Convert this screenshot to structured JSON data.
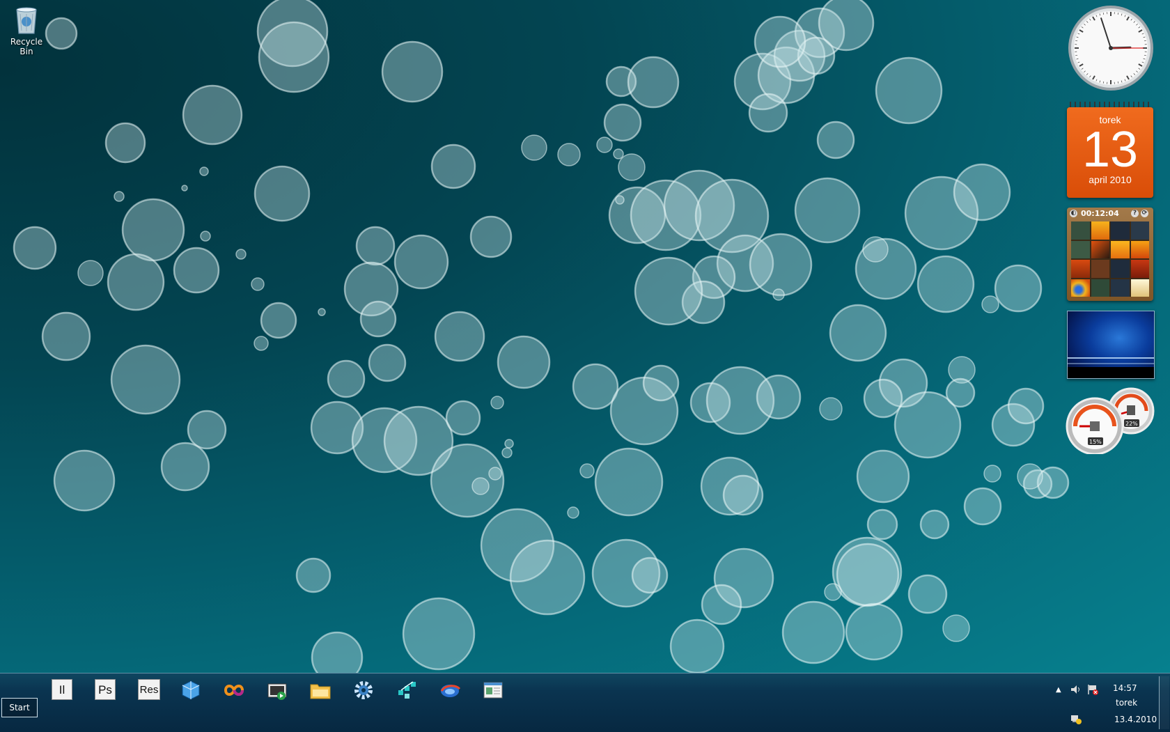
{
  "desktop": {
    "icons": [
      {
        "label": "Recycle Bin",
        "icon": "recycle-bin-icon"
      }
    ]
  },
  "gadgets": {
    "clock": {
      "hour": 2,
      "minute": 57,
      "second": 15
    },
    "calendar": {
      "day_name": "torek",
      "date": "13",
      "month_year": "april 2010",
      "accent": "#e55b12"
    },
    "puzzle": {
      "timer": "00:12:04"
    },
    "meter": {
      "cpu_percent": "15%",
      "memory_percent": "22%"
    }
  },
  "taskbar": {
    "start_label": "Start",
    "pinned": [
      {
        "name": "illustrator",
        "label": "Il"
      },
      {
        "name": "photoshop",
        "label": "Ps"
      },
      {
        "name": "resource-hacker",
        "label": "Res"
      },
      {
        "name": "virtualbox",
        "icon": "virtualbox-icon"
      },
      {
        "name": "visual-studio",
        "icon": "infinity-icon"
      },
      {
        "name": "media-center",
        "icon": "media-center-icon"
      },
      {
        "name": "windows-explorer",
        "icon": "folder-icon"
      },
      {
        "name": "settings",
        "icon": "gear-icon"
      },
      {
        "name": "network",
        "icon": "network-icon"
      },
      {
        "name": "browser",
        "icon": "browser-icon"
      },
      {
        "name": "document",
        "icon": "document-icon"
      }
    ],
    "tray": {
      "time": "14:57",
      "day": "torek",
      "date": "13.4.2010"
    }
  },
  "colors": {
    "desktop_dark": "#02323c",
    "desktop_light": "#06808e",
    "taskbar": "#0a3450"
  }
}
